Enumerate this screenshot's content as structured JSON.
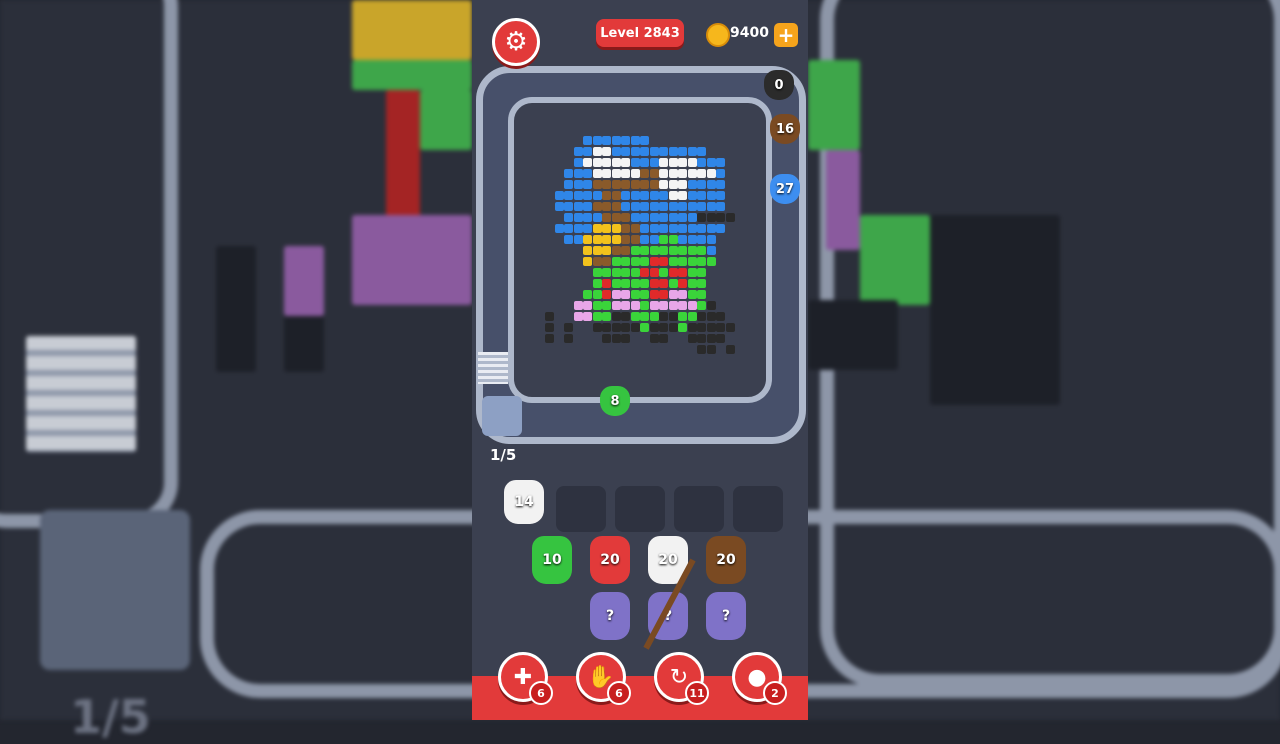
{
  "header": {
    "level_label": "Level 2843",
    "coins": "9400",
    "coin_plus": "+"
  },
  "colors": {
    "accent_red": "#e23a3a",
    "track": "#aeb8cb",
    "coin": "#f6b71c"
  },
  "conveyor_pigs": [
    {
      "value": "0",
      "color": "#2b2b2b"
    },
    {
      "value": "16",
      "color": "#7a4a22"
    },
    {
      "value": "27",
      "color": "#3d8ef0"
    }
  ],
  "shooter_pig": {
    "value": "8",
    "color": "#36c440"
  },
  "queue_counter": "1/5",
  "holding_slots": [
    {
      "value": "14",
      "color": "#f2f2f2"
    }
  ],
  "pig_columns": [
    {
      "value": "10",
      "color": "#36c440"
    },
    {
      "value": "20",
      "color": "#e23a3a"
    },
    {
      "value": "20",
      "color": "#f2f2f2"
    },
    {
      "value": "20",
      "color": "#7a4a22"
    }
  ],
  "mystery_pigs": [
    "?",
    "?",
    "?"
  ],
  "tools": [
    {
      "icon": "add-slot-icon",
      "badge": "6"
    },
    {
      "icon": "hand-icon",
      "badge": "6"
    },
    {
      "icon": "shuffle-icon",
      "badge": "11"
    },
    {
      "icon": "pig-icon",
      "badge": "2"
    }
  ]
}
